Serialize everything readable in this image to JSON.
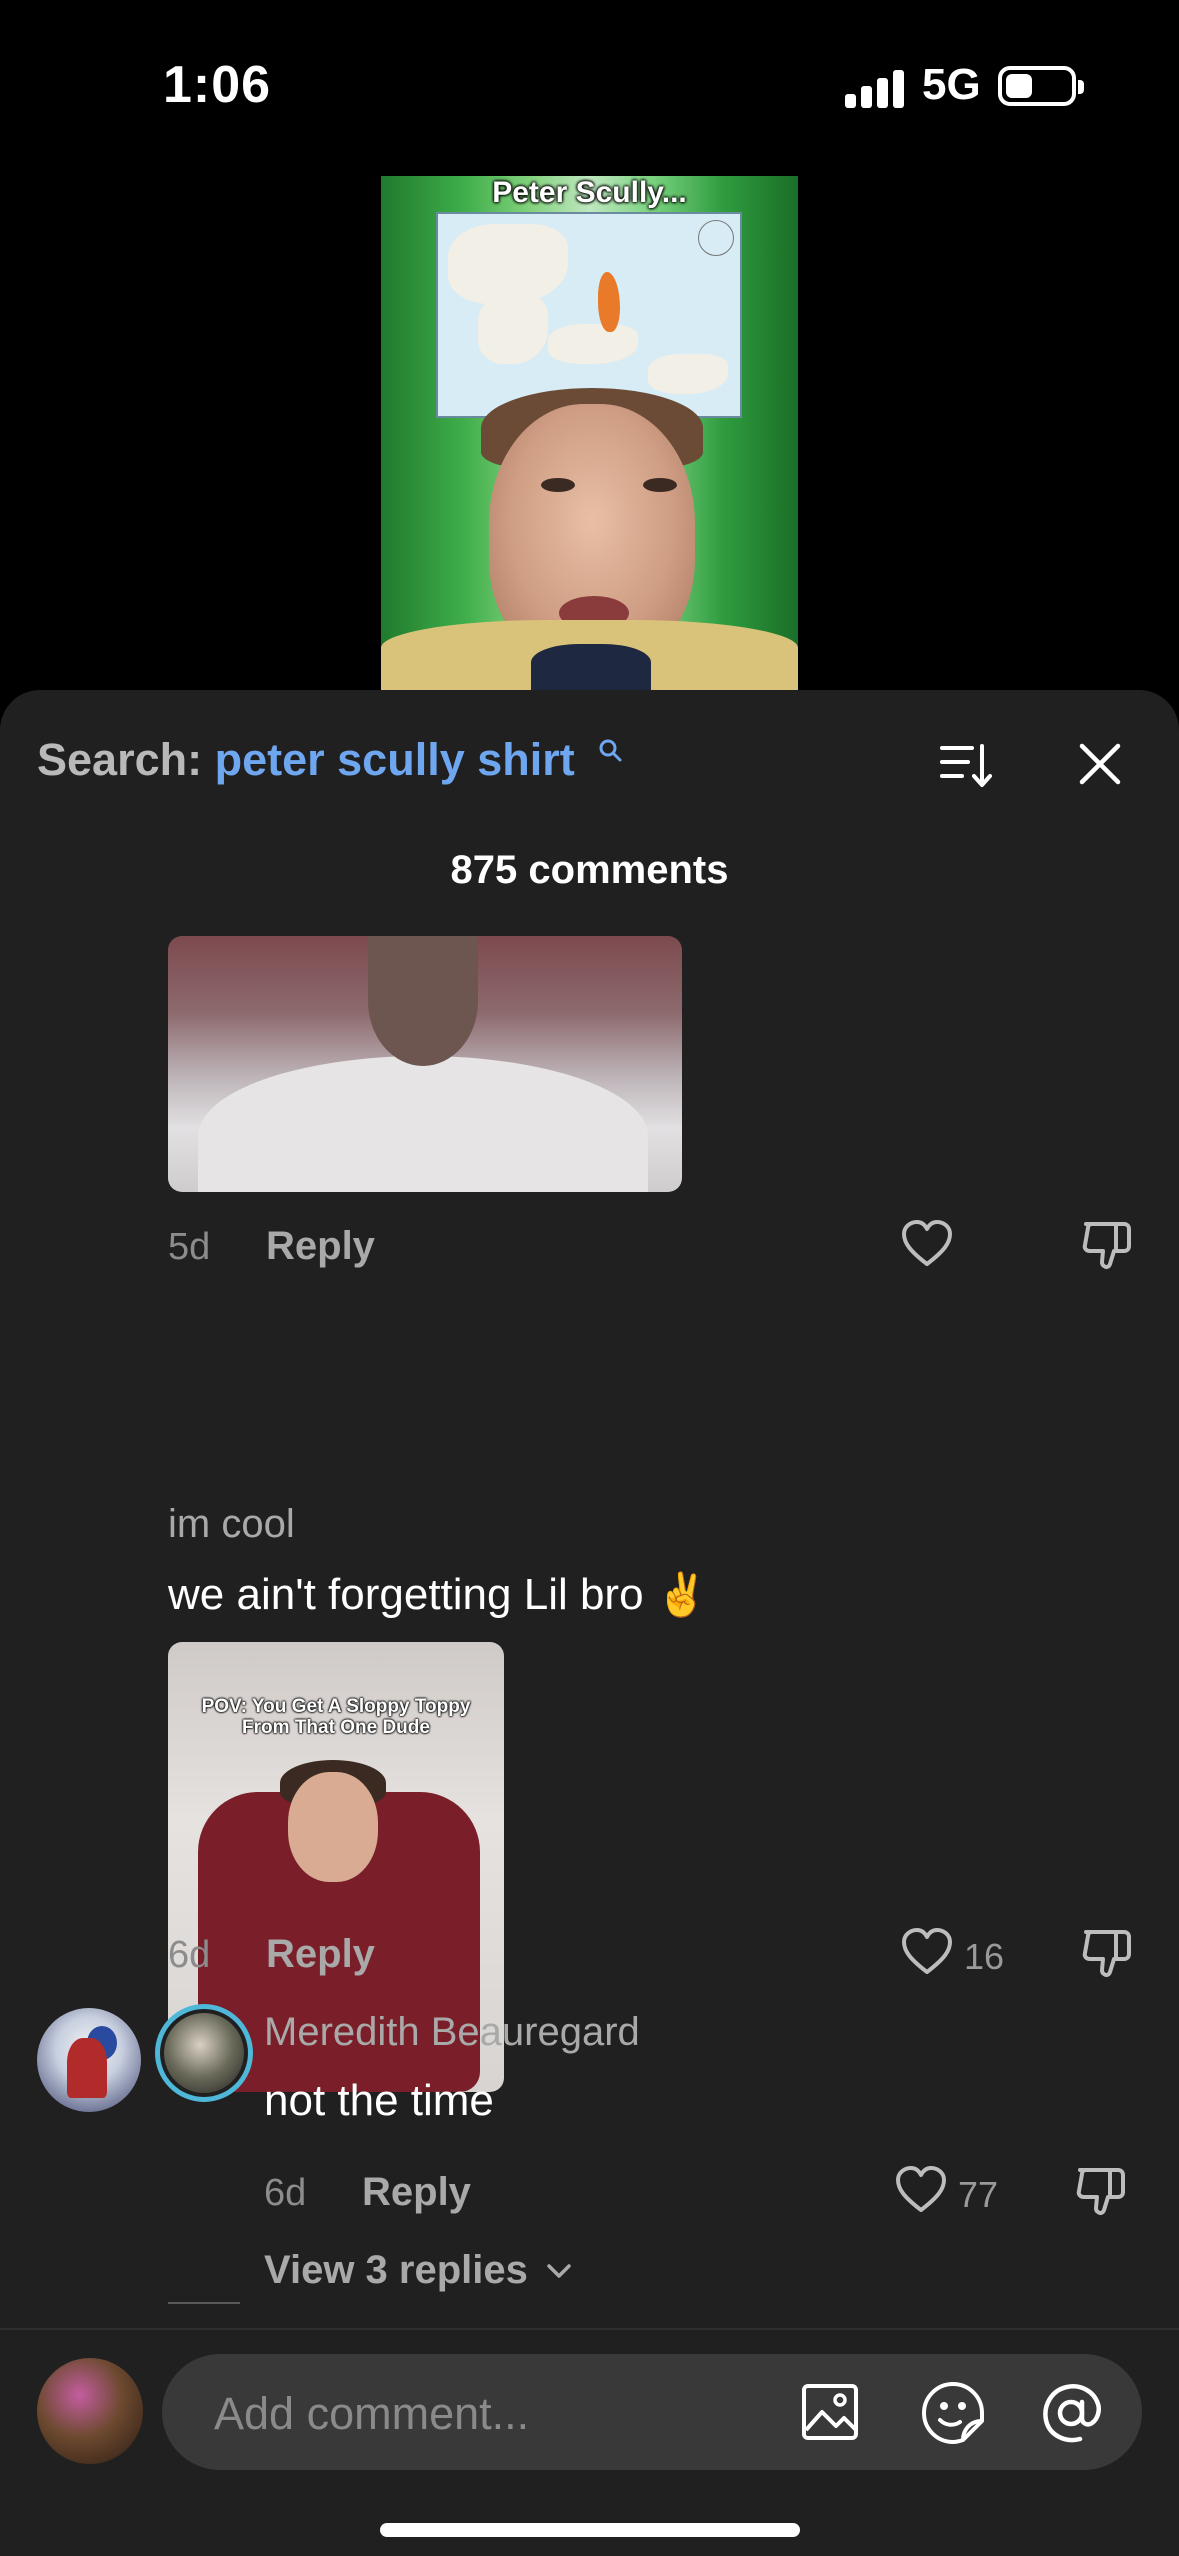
{
  "status_bar": {
    "time": "1:06",
    "network": "5G"
  },
  "video": {
    "caption": "Peter Scully..."
  },
  "search": {
    "label": "Search:",
    "term": "peter scully shirt"
  },
  "comment_count": "875 comments",
  "comments": [
    {
      "time": "5d",
      "reply_label": "Reply",
      "like_count": ""
    },
    {
      "username": "im cool",
      "text": "we ain't forgetting Lil bro",
      "emoji": "✌️",
      "image_caption": "POV: You Get A Sloppy Toppy From That One Dude",
      "time": "6d",
      "reply_label": "Reply",
      "like_count": "16",
      "replies": [
        {
          "username": "Meredith Beauregard",
          "text": "not the time",
          "time": "6d",
          "reply_label": "Reply",
          "like_count": "77"
        }
      ],
      "view_replies": "View 3 replies"
    }
  ],
  "composer": {
    "placeholder": "Add comment..."
  },
  "icons": {
    "search": "search-icon",
    "sort": "sort-icon",
    "close": "close-icon",
    "like": "heart-icon",
    "dislike": "thumbs-down-icon",
    "image": "image-icon",
    "sticker": "sticker-icon",
    "mention": "at-icon"
  },
  "colors": {
    "accent": "#6fa6f0",
    "panel": "#202020",
    "ring": "#4fb7d8"
  }
}
